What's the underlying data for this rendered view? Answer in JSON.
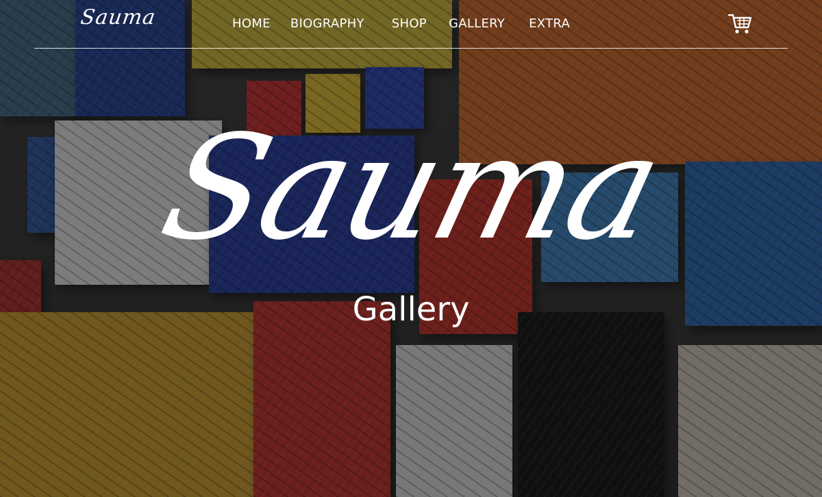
{
  "header": {
    "logo_text": "Sauma",
    "nav": [
      {
        "label": "HOME"
      },
      {
        "label": "BIOGRAPHY"
      },
      {
        "label": "SHOP"
      },
      {
        "label": "GALLERY"
      },
      {
        "label": "EXTRA"
      }
    ],
    "cart_icon": "shopping-cart-icon"
  },
  "hero": {
    "title": "Sauma",
    "subtitle": "Gallery"
  },
  "colors": {
    "text": "#ffffff",
    "overlay": "#141414"
  }
}
